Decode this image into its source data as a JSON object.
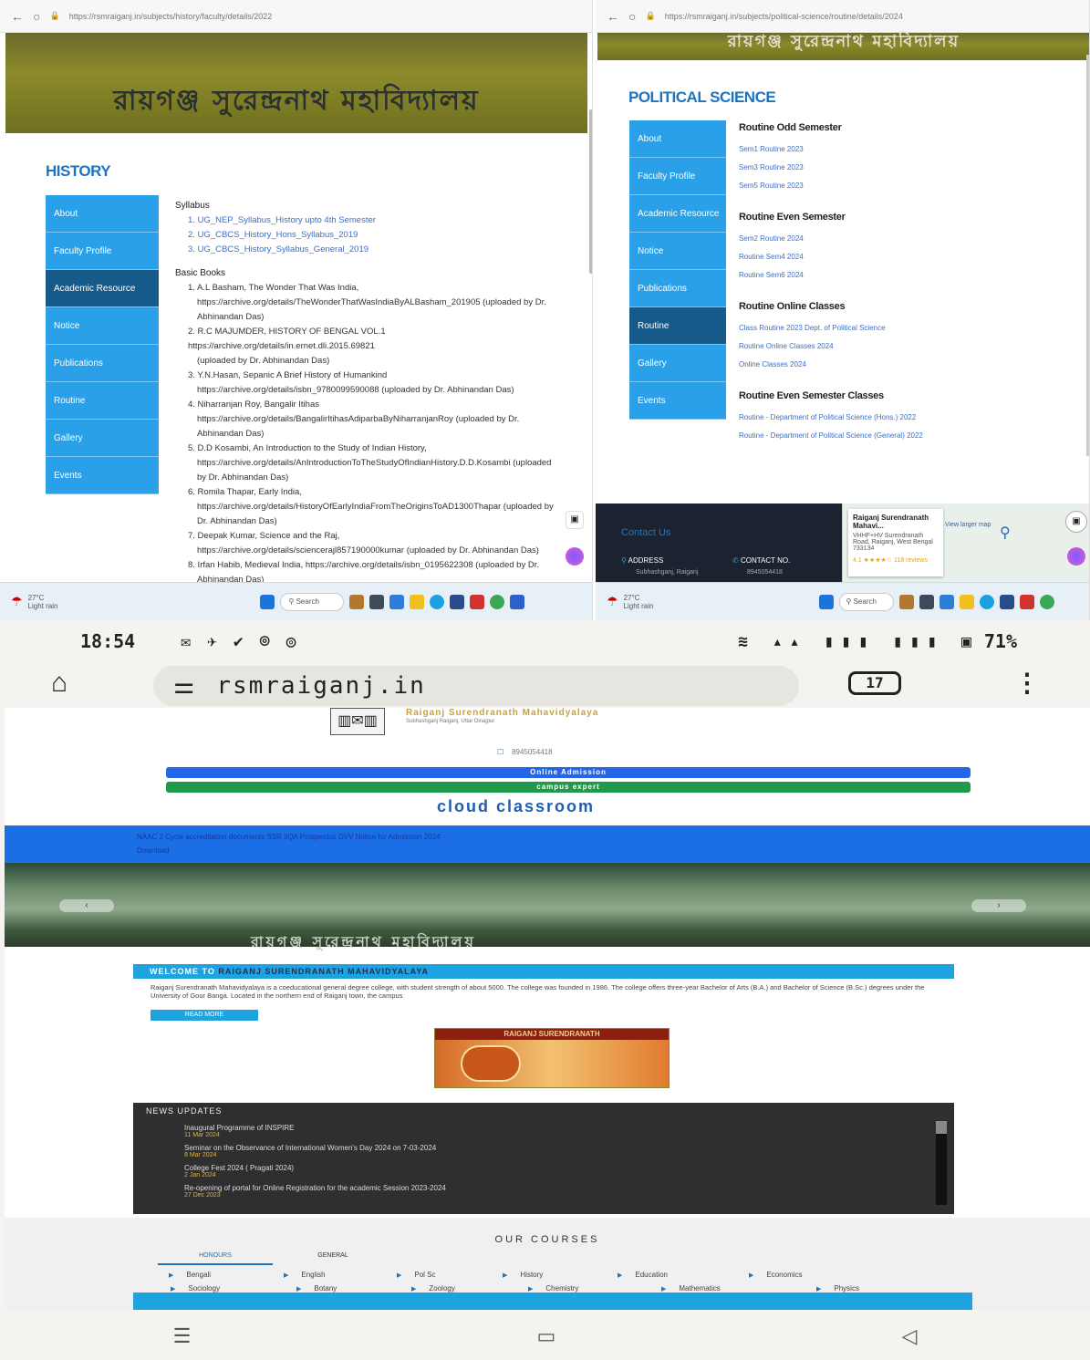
{
  "left_window": {
    "url": "https://rsmraiganj.in/subjects/history/faculty/details/2022",
    "banner_text": "রায়গঞ্জ সুরেন্দ্রনাথ মহাবিদ্যালয়",
    "dept_title": "HISTORY",
    "menu": [
      "About",
      "Faculty Profile",
      "Academic Resource",
      "Notice",
      "Publications",
      "Routine",
      "Gallery",
      "Events"
    ],
    "active_menu_index": 2,
    "syllabus_heading": "Syllabus",
    "syllabus_items": [
      "1. UG_NEP_Syllabus_History upto 4th Semester",
      "2. UG_CBCS_History_Hons_Syllabus_2019",
      "3. UG_CBCS_History_Syllabus_General_2019"
    ],
    "books_heading": "Basic Books",
    "books": [
      "1. A.L Basham, The Wonder That Was India,",
      "https://archive.org/details/TheWonderThatWasIndiaByALBasham_201905 (uploaded by Dr.",
      "Abhinandan Das)",
      "2. R.C MAJUMDER, HISTORY OF BENGAL VOL.1 https://archive.org/details/in.ernet.dli.2015.69821",
      "(uploaded by Dr. Abhinandan Das)",
      "3. Y.N.Hasan, Sepanic A Brief History of Humankind",
      "https://archive.org/details/isbn_9780099590088 (uploaded by Dr. Abhinandan Das)",
      "4. Niharranjan Roy, Bangalir Itihas",
      "https://archive.org/details/BangalirItihasAdiparbaByNiharranjanRoy (uploaded by Dr.",
      "Abhinandan Das)",
      "5. D.D Kosambi, An Introduction to the Study of Indian History,",
      "https://archive.org/details/AnIntroductionToTheStudyOfIndianHistory.D.D.Kosambi (uploaded",
      "by Dr. Abhinandan Das)",
      "6. Romila Thapar, Early India,",
      "https://archive.org/details/HistoryOfEarlyIndiaFromTheOriginsToAD1300Thapar (uploaded by",
      "Dr. Abhinandan Das)",
      "7. Deepak Kumar, Science and the Raj,",
      "https://archive.org/details/sciencerajl857190000kumar (uploaded by Dr. Abhinandan Das)",
      "8. Irfan Habib, Medieval India, https://archive.org/details/isbn_0195622308 (uploaded by Dr.",
      "Abhinandan Das)"
    ],
    "weather": "27°C",
    "weather_sub": "Light rain",
    "search_label": "Search"
  },
  "right_window": {
    "url": "https://rsmraiganj.in/subjects/political-science/routine/details/2024",
    "banner_text": "রায়গঞ্জ সুরেন্দ্রনাথ মহাবিদ্যালয়",
    "dept_title": "POLITICAL SCIENCE",
    "menu": [
      "About",
      "Faculty Profile",
      "Academic Resource",
      "Notice",
      "Publications",
      "Routine",
      "Gallery",
      "Events"
    ],
    "active_menu_index": 5,
    "sections": [
      {
        "heading": "Routine Odd Semester",
        "links": [
          "Sem1 Routine 2023",
          "Sem3 Routine 2023",
          "Sem5 Routine 2023"
        ]
      },
      {
        "heading": "Routine Even Semester",
        "links": [
          "Sem2 Routine 2024",
          "Routine Sem4 2024",
          "Routine Sem6 2024"
        ]
      },
      {
        "heading": "Routine Online Classes",
        "links": [
          "Class Routine 2023 Dept. of Political Science",
          "Routine Online Classes 2024",
          "Online Classes 2024"
        ]
      },
      {
        "heading": "Routine Even Semester Classes",
        "links": [
          "Routine - Department of Political Science (Hons.) 2022",
          "Routine - Department of Political Science (General) 2022"
        ]
      }
    ],
    "footer_contact": "Contact Us",
    "footer_address": "ADDRESS",
    "footer_address_sub": "Subhashganj, Raiganj",
    "footer_contact_no": "CONTACT NO.",
    "footer_contact_no_sub": "8945054418",
    "map_title": "Raiganj Surendranath Mahavi...",
    "map_sub": "VHHF+HV Surendranath Road, Raiganj, West Bengal 733134",
    "map_rating": "4.1 ★★★★☆ 118 reviews",
    "map_link": "View larger map",
    "weather": "27°C",
    "weather_sub": "Light rain",
    "search_label": "Search"
  },
  "phone": {
    "time": "18:54",
    "battery": "71%",
    "url": "rsmraiganj.in",
    "tab_count": "17",
    "college_name": "Raiganj Surendranath Mahavidyalaya",
    "college_sub": "Subhashganj Raiganj, Uttar Dinajpur",
    "phone_number": "8945054418",
    "btn_admission": "Online Admission",
    "btn_campus": "campus expert",
    "cloud_classroom": "cloud classroom",
    "ticker": "NAAC 2 Cycle accreditation documents  SSR  IIQA  Prospectus  DVV  Notice for Admission 2024",
    "ticker2": "Download",
    "hero_text": "রায়গঞ্জ সুরেন্দ্রনাথ মহাবিদ্যালয়",
    "welcome_prefix": "WELCOME TO ",
    "welcome_name": "RAIGANJ SURENDRANATH MAHAVIDYALAYA",
    "welcome_text": "Raiganj Surendranath Mahavidyalaya is a coeducational general degree college, with student strength of about 5000. The college was founded in 1986. The college offers three-year Bachelor of Arts (B.A.) and Bachelor of Science (B.Sc.) degrees under the University of Gour Banga. Located in the northern end of Raiganj town, the campus",
    "read_more": "READ MORE",
    "promo_title": "RAIGANJ SURENDRANATH",
    "news_title": "NEWS UPDATES",
    "news": [
      {
        "title": "Inaugural Programme of INSPIRE",
        "date": "11 Mar 2024"
      },
      {
        "title": "Seminar on the Observance of International Women's Day 2024 on 7-03-2024",
        "date": "8 Mar 2024"
      },
      {
        "title": "College Fest 2024 ( Pragati 2024)",
        "date": "2 Jan 2024"
      },
      {
        "title": "Re-opening of portal for Online Registration for the academic Session 2023-2024",
        "date": "27 Dec 2023"
      }
    ],
    "courses_title": "OUR COURSES",
    "course_tabs": [
      "HONOURS",
      "GENERAL"
    ],
    "courses_row1": [
      "Bengali",
      "English",
      "Pol Sc",
      "History",
      "Education",
      "Economics"
    ],
    "courses_row2": [
      "Sociology",
      "Botany",
      "Zoology",
      "Chemistry",
      "Mathematics",
      "Physics"
    ]
  },
  "colors": {
    "accent_blue": "#2aa0e8",
    "active_blue": "#165a8a",
    "link_blue": "#3a6fc6",
    "title_blue": "#1e73be"
  }
}
